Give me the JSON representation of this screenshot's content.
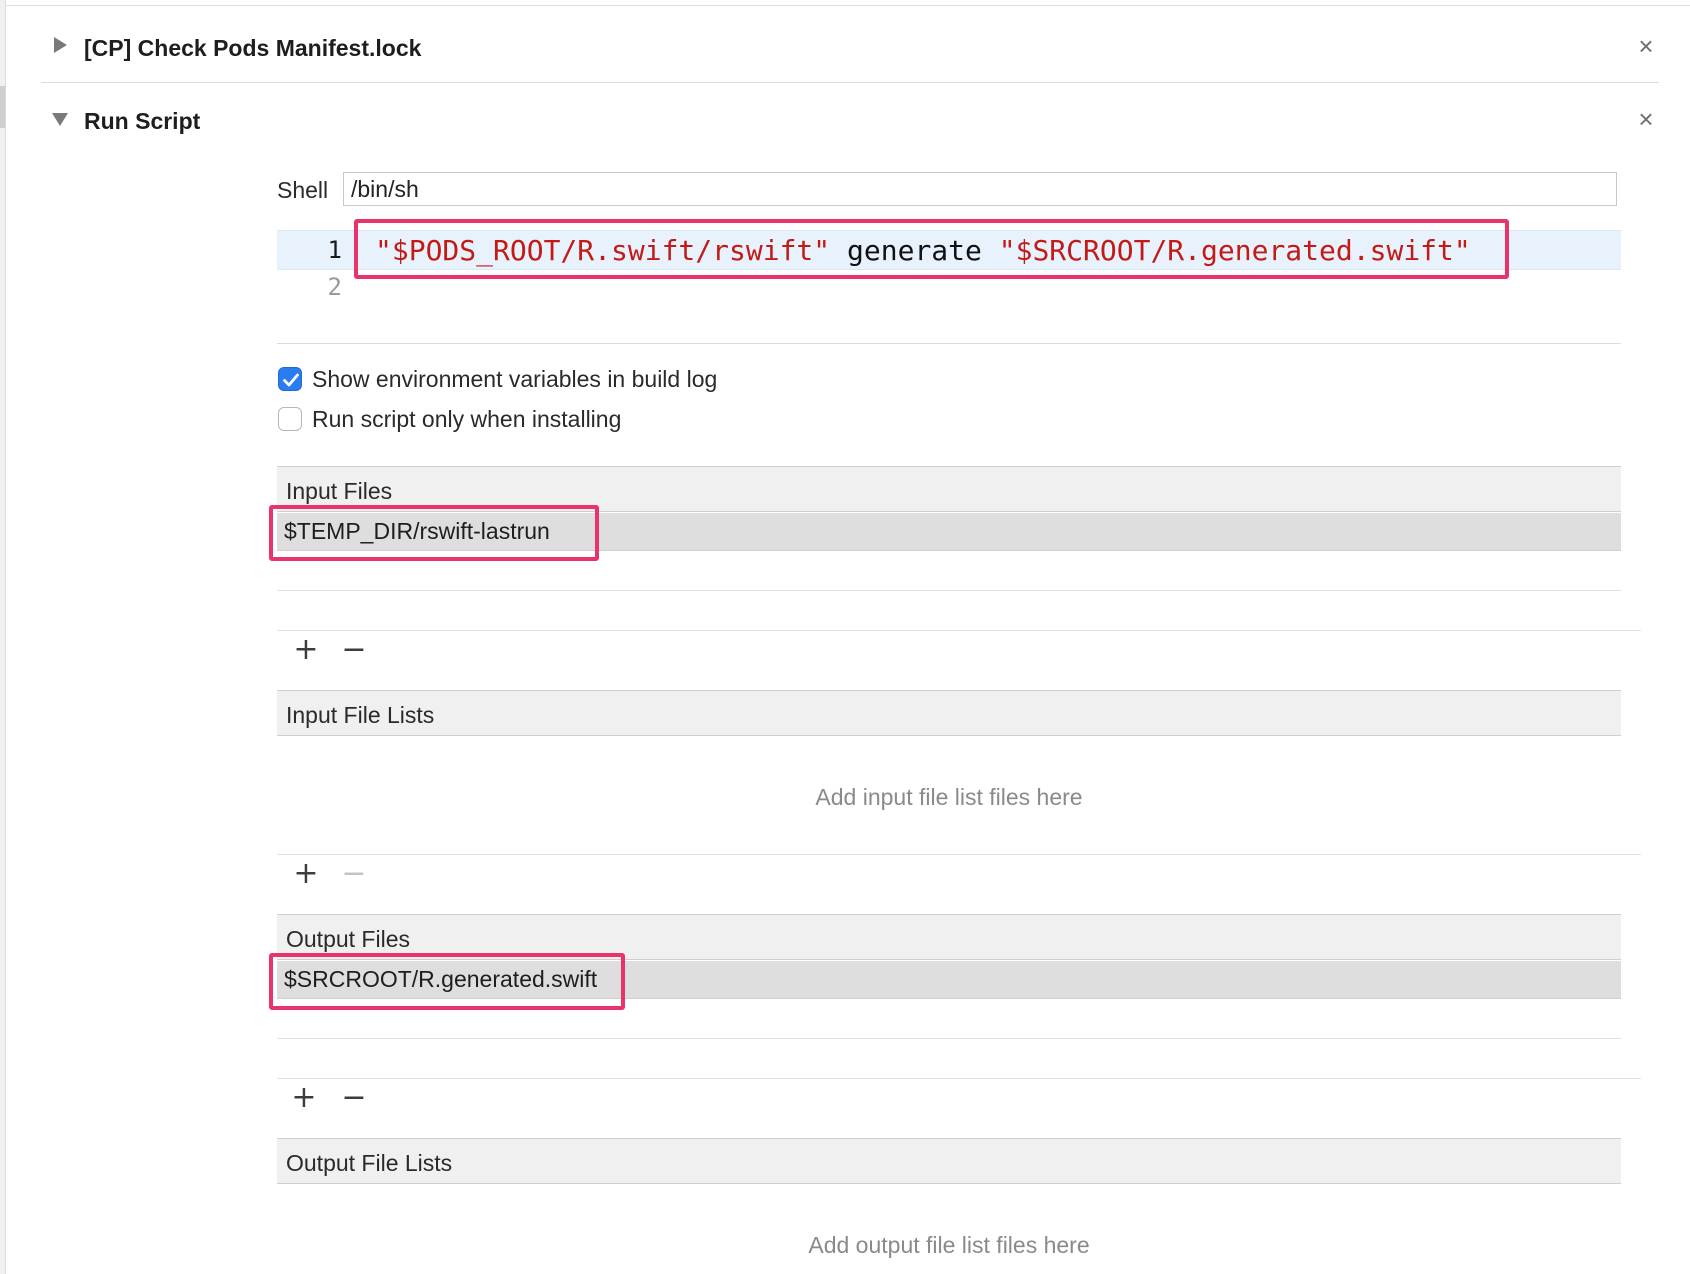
{
  "phases": {
    "check_pods": {
      "title": "[CP] Check Pods Manifest.lock",
      "close_glyph": "×"
    },
    "run_script": {
      "title": "Run Script",
      "close_glyph": "×"
    }
  },
  "shell": {
    "label": "Shell",
    "value": "/bin/sh"
  },
  "editor": {
    "line_numbers": [
      "1",
      "2"
    ],
    "line1": {
      "str1": "\"$PODS_ROOT/R.swift/rswift\"",
      "plain": " generate ",
      "str2": "\"$SRCROOT/R.generated.swift\""
    }
  },
  "options": {
    "show_env": {
      "label": "Show environment variables in build log",
      "checked": true
    },
    "run_only_installing": {
      "label": "Run script only when installing",
      "checked": false
    }
  },
  "input_files": {
    "title": "Input Files",
    "items": [
      "$TEMP_DIR/rswift-lastrun"
    ]
  },
  "input_file_lists": {
    "title": "Input File Lists",
    "placeholder": "Add input file list files here"
  },
  "output_files": {
    "title": "Output Files",
    "items": [
      "$SRCROOT/R.generated.swift"
    ]
  },
  "output_file_lists": {
    "title": "Output File Lists",
    "placeholder": "Add output file list files here"
  },
  "buttons": {
    "add": "+",
    "remove": "−"
  },
  "colors": {
    "highlight": "#e8336b",
    "string": "#c41a16",
    "checkbox_accent": "#2b7cf0"
  },
  "icons": {
    "collapsed": "disclosure-right-icon",
    "expanded": "disclosure-down-icon",
    "close": "close-icon"
  }
}
